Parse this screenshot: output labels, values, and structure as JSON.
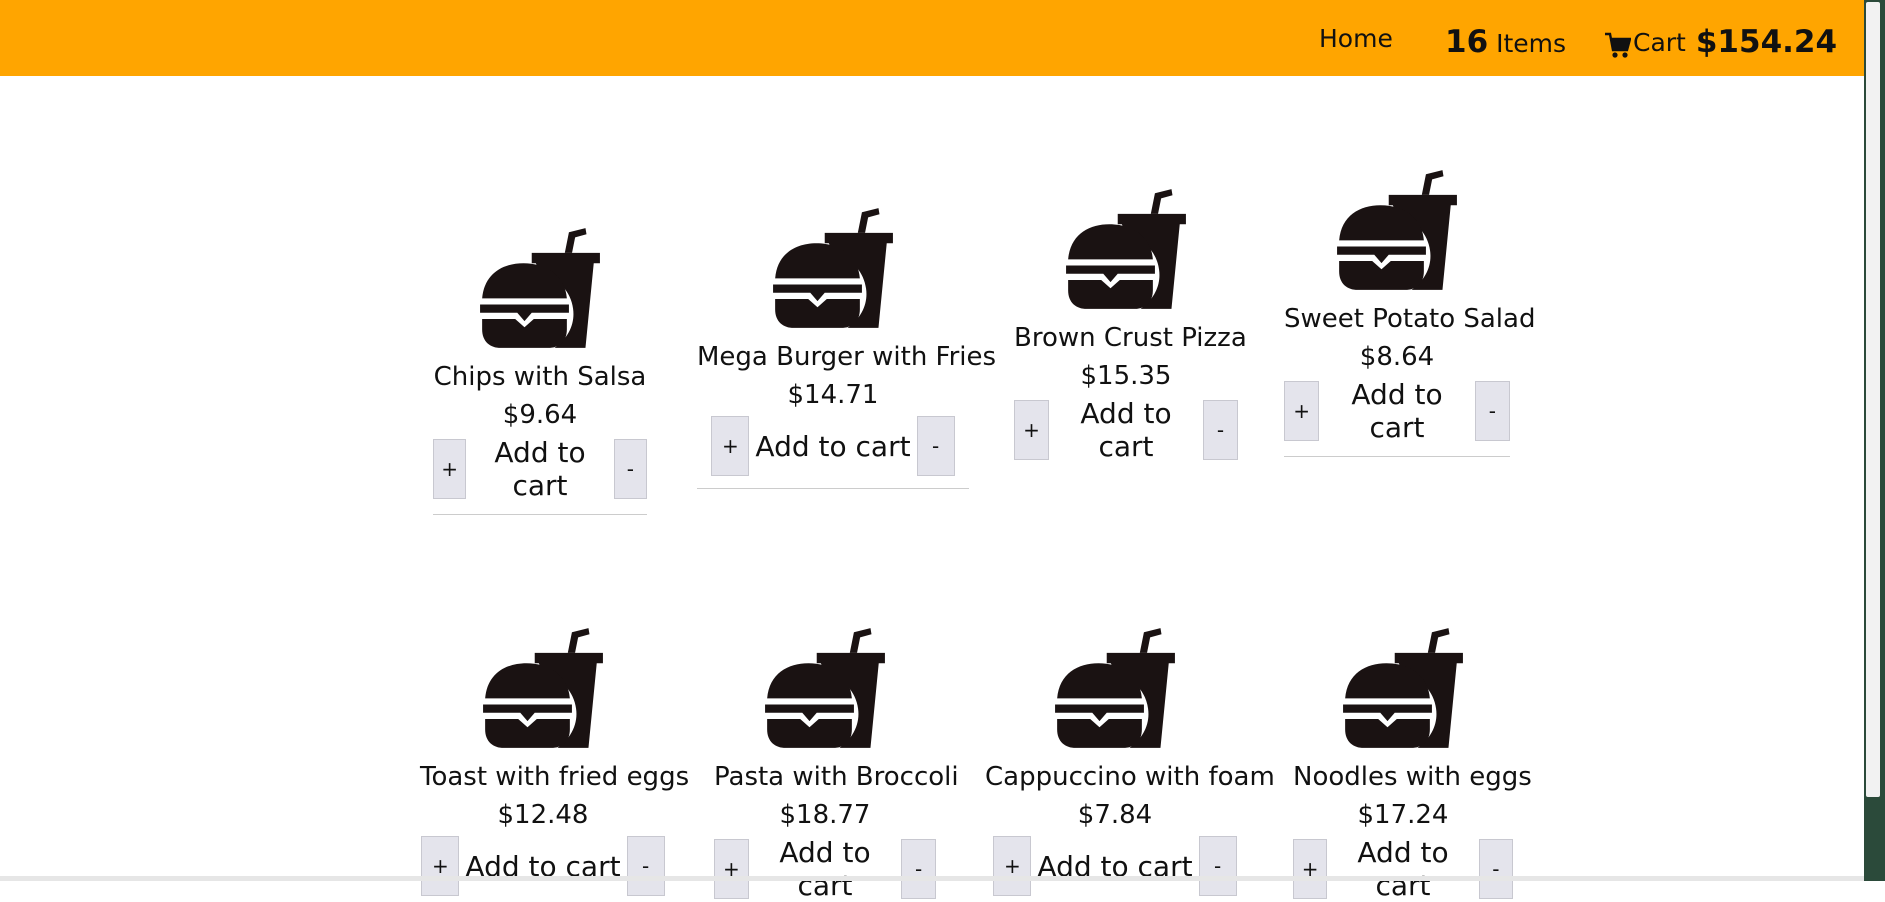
{
  "header": {
    "home_label": "Home",
    "items_count": "16",
    "items_label": "Items",
    "cart_label": "Cart",
    "cart_total": "$154.24"
  },
  "product_icon": "burger-and-drink-icon",
  "add_to_cart_label": "Add to cart",
  "plus_label": "+",
  "minus_label": "-",
  "products": [
    {
      "name": "Chips with Salsa",
      "price": "$9.64"
    },
    {
      "name": "Mega Burger with Fries",
      "price": "$14.71"
    },
    {
      "name": "Brown Crust Pizza",
      "price": "$15.35"
    },
    {
      "name": "Sweet Potato Salad",
      "price": "$8.64"
    },
    {
      "name": "Toast with fried eggs",
      "price": "$12.48"
    },
    {
      "name": "Pasta with Broccoli",
      "price": "$18.77"
    },
    {
      "name": "Cappuccino with foam",
      "price": "$7.84"
    },
    {
      "name": "Noodles with eggs",
      "price": "$17.24"
    }
  ],
  "colors": {
    "header_bg": "#ffa500",
    "button_bg": "#e4e4ec",
    "icon": "#1a1212"
  }
}
